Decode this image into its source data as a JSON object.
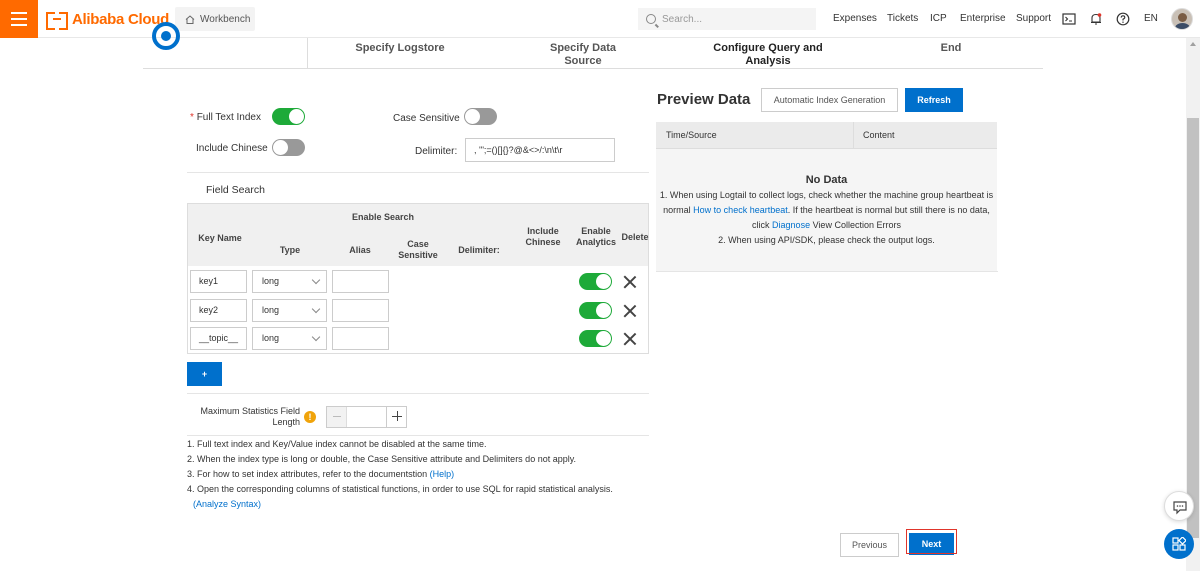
{
  "header": {
    "brand": "Alibaba Cloud",
    "workbench": "Workbench",
    "search_placeholder": "Search...",
    "links": [
      "Expenses",
      "Tickets",
      "ICP",
      "Enterprise",
      "Support"
    ],
    "language": "EN"
  },
  "steps": [
    {
      "label": "Specify Logstore"
    },
    {
      "label": "Specify Data Source"
    },
    {
      "label": "Configure Query and Analysis"
    },
    {
      "label": "End"
    }
  ],
  "index": {
    "full_text_label": "Full Text Index",
    "required_mark": "*",
    "case_sensitive_label": "Case Sensitive",
    "include_chinese_label": "Include Chinese",
    "delimiter_label": "Delimiter:",
    "delimiter_value": ", '\";=()[]{}?@&<>/:\\n\\t\\r",
    "full_text_on": true,
    "case_sensitive_on": false,
    "include_chinese_on": false
  },
  "field_search": {
    "title": "Field Search",
    "headers": {
      "key_name": "Key Name",
      "enable_search": "Enable Search",
      "type": "Type",
      "alias": "Alias",
      "case_sensitive": "Case Sensitive",
      "delimiter": "Delimiter:",
      "include_chinese": "Include Chinese",
      "enable_analytics": "Enable Analytics",
      "delete": "Delete"
    },
    "rows": [
      {
        "key": "key1",
        "type": "long",
        "alias": "",
        "analytics": true
      },
      {
        "key": "key2",
        "type": "long",
        "alias": "",
        "analytics": true
      },
      {
        "key": "__topic__",
        "type": "long",
        "alias": "",
        "analytics": true
      }
    ],
    "add_label": "+"
  },
  "max_stats": {
    "label": "Maximum Statistics Field Length",
    "warn": "!",
    "value": ""
  },
  "notes": {
    "n1": "1. Full text index and Key/Value index cannot be disabled at the same time.",
    "n2": "2. When the index type is long or double, the Case Sensitive attribute and Delimiters do not apply.",
    "n3": "3. For how to set index attributes, refer to the documentstion",
    "n3_link": "(Help)",
    "n4": "4. Open the corresponding columns of statistical functions, in order to use SQL for rapid statistical analysis.",
    "n4_link": "(Analyze Syntax)"
  },
  "preview": {
    "title": "Preview Data",
    "auto_index_label": "Automatic Index Generation",
    "refresh_label": "Refresh",
    "col_time": "Time/Source",
    "col_content": "Content",
    "empty_title": "No Data",
    "line1": "1. When using Logtail to collect logs, check whether the machine group heartbeat is",
    "line2a": "normal",
    "line2_link": "How to check heartbeat",
    "line2b": ". If the heartbeat is normal but still there is no data,",
    "line3a": "click",
    "line3_link": "Diagnose",
    "line3b": "View Collection Errors",
    "line4": "2. When using API/SDK, please check the output logs."
  },
  "footer": {
    "previous_label": "Previous",
    "next_label": "Next"
  },
  "colors": {
    "brand_orange": "#ff6a00",
    "primary_blue": "#0070cc",
    "toggle_green": "#1eaa39",
    "highlight_red": "#e0352b"
  }
}
